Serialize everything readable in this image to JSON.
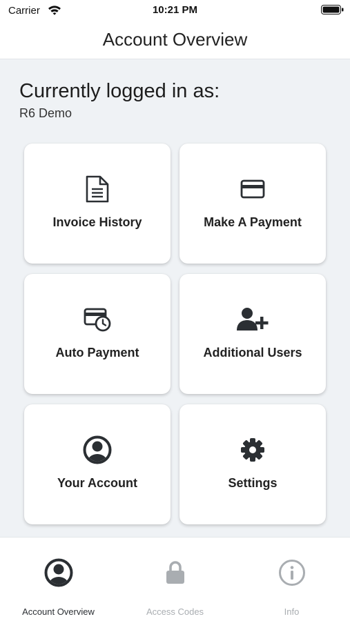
{
  "status_bar": {
    "carrier": "Carrier",
    "time": "10:21 PM"
  },
  "nav": {
    "title": "Account Overview"
  },
  "session": {
    "heading": "Currently logged in as:",
    "user": "R6 Demo"
  },
  "cards": [
    {
      "label": "Invoice History",
      "icon": "document-icon"
    },
    {
      "label": "Make A Payment",
      "icon": "credit-card-icon"
    },
    {
      "label": "Auto Payment",
      "icon": "card-clock-icon"
    },
    {
      "label": "Additional Users",
      "icon": "user-plus-icon"
    },
    {
      "label": "Your Account",
      "icon": "user-circle-icon"
    },
    {
      "label": "Settings",
      "icon": "gear-icon"
    }
  ],
  "tabs": [
    {
      "label": "Account Overview",
      "icon": "user-circle-icon",
      "active": true
    },
    {
      "label": "Access Codes",
      "icon": "lock-icon",
      "active": false
    },
    {
      "label": "Info",
      "icon": "info-icon",
      "active": false
    }
  ],
  "colors": {
    "background": "#eff2f5",
    "card": "#ffffff",
    "icon": "#2b2f33",
    "tab_active": "#2b2f33",
    "tab_inactive": "#a9adb1"
  }
}
